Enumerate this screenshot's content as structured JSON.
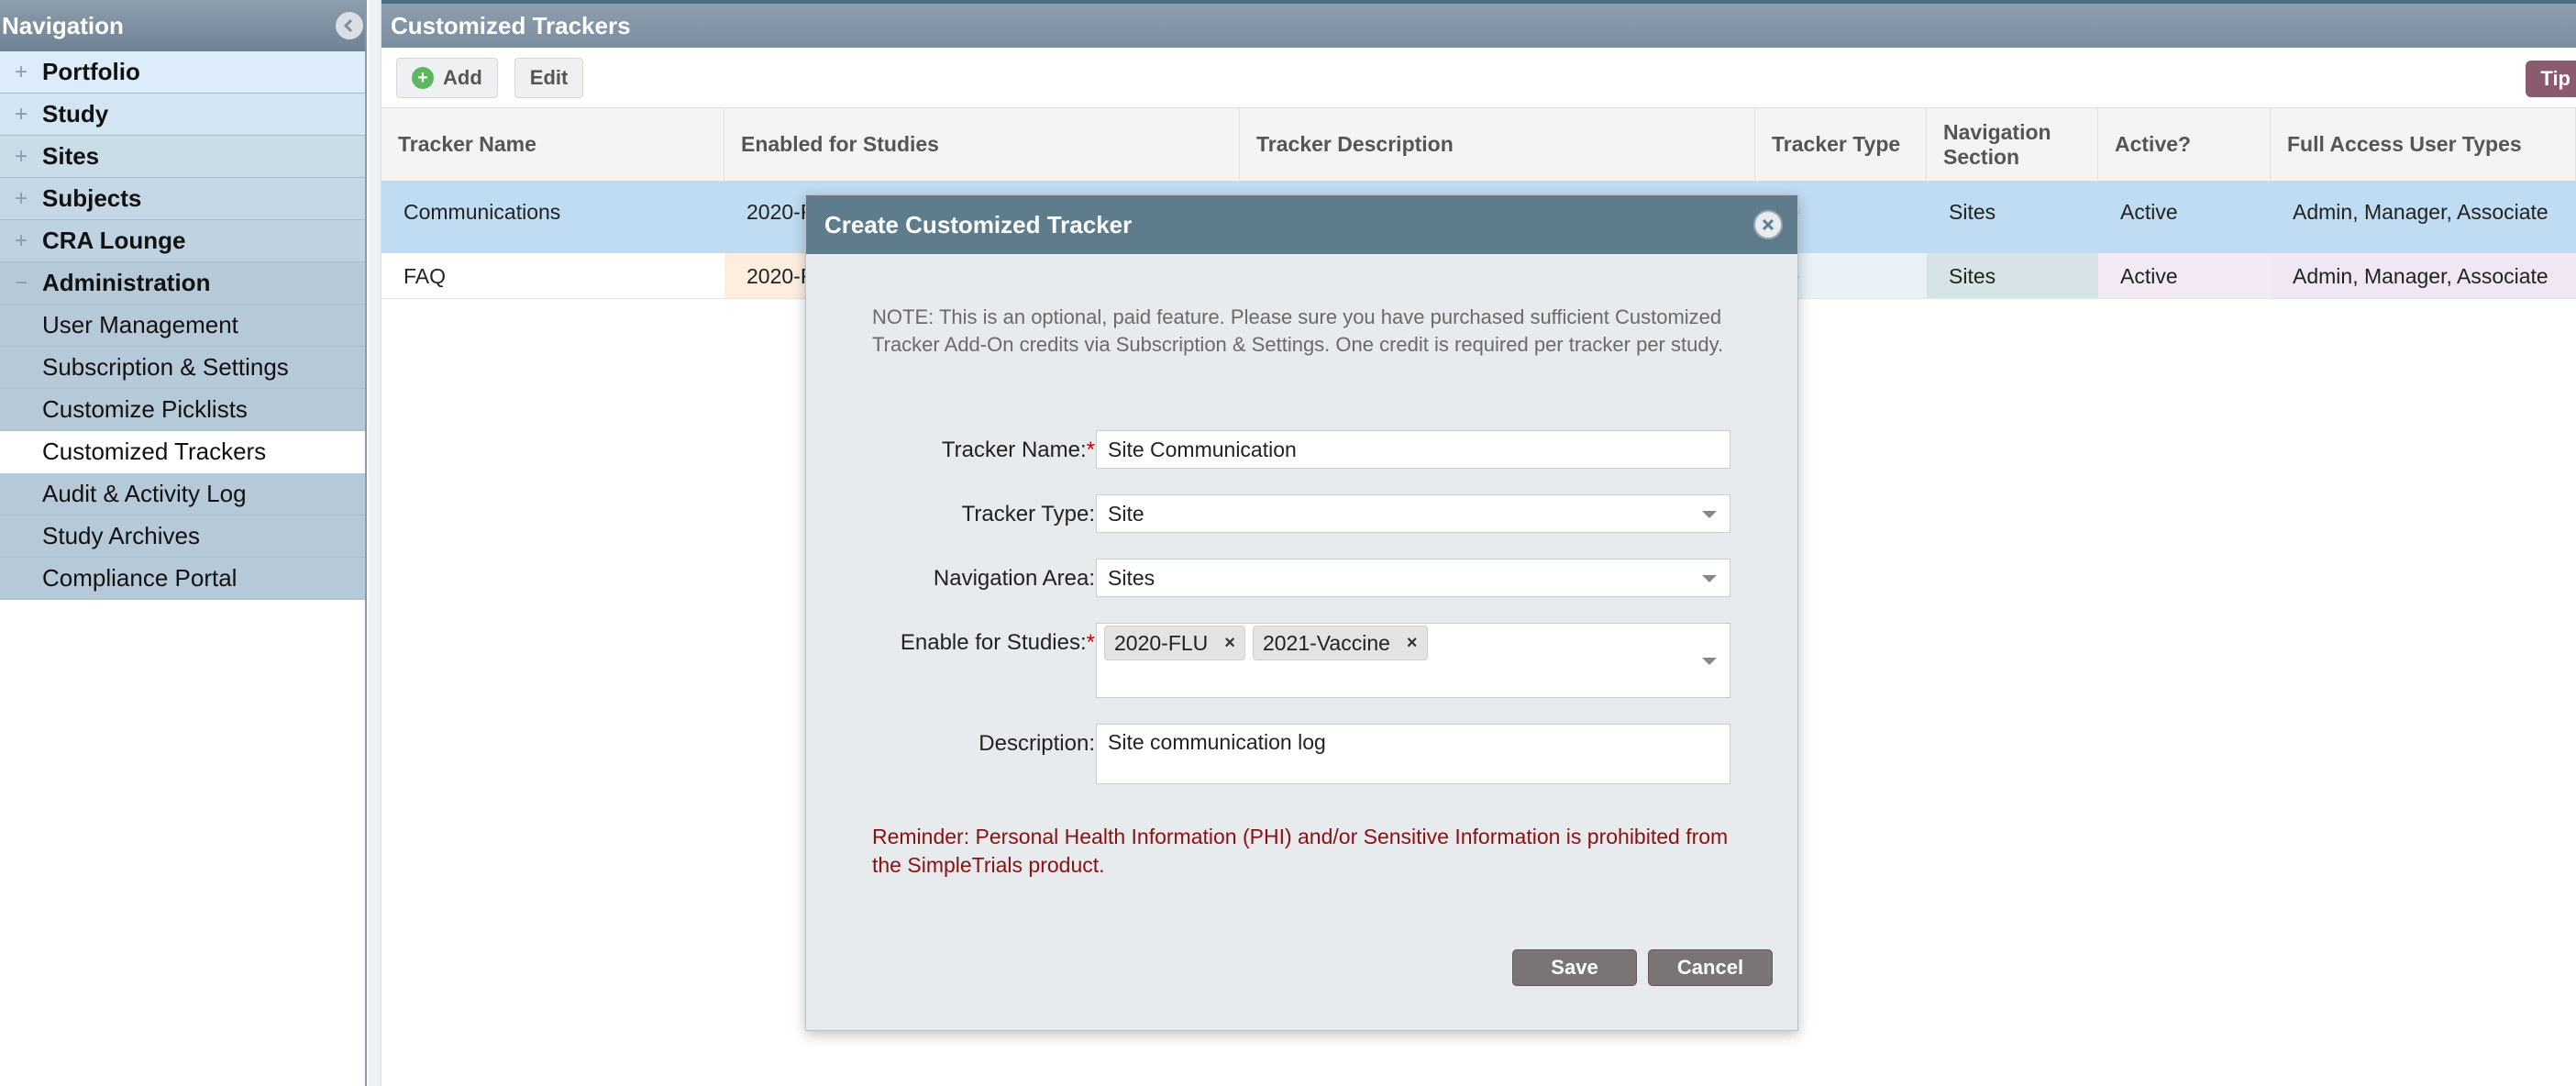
{
  "sidebar": {
    "title": "Navigation",
    "items": [
      {
        "label": "Portfolio",
        "toggle": "+"
      },
      {
        "label": "Study",
        "toggle": "+"
      },
      {
        "label": "Sites",
        "toggle": "+"
      },
      {
        "label": "Subjects",
        "toggle": "+"
      },
      {
        "label": "CRA Lounge",
        "toggle": "+"
      },
      {
        "label": "Administration",
        "toggle": "−"
      }
    ],
    "subitems": [
      {
        "label": "User Management"
      },
      {
        "label": "Subscription & Settings"
      },
      {
        "label": "Customize Picklists"
      },
      {
        "label": "Customized Trackers"
      },
      {
        "label": "Audit & Activity Log"
      },
      {
        "label": "Study Archives"
      },
      {
        "label": "Compliance Portal"
      }
    ]
  },
  "main": {
    "title": "Customized Trackers",
    "toolbar": {
      "add_label": "Add",
      "edit_label": "Edit",
      "tips_label": "Tip"
    }
  },
  "table": {
    "columns": [
      "Tracker Name",
      "Enabled for Studies",
      "Tracker Description",
      "Tracker Type",
      "Navigation Section",
      "Active?",
      "Full Access User Types"
    ],
    "rows": [
      {
        "name": "Communications",
        "studies": "2020-F",
        "description": "",
        "type": "ite",
        "section": "Sites",
        "active": "Active",
        "access": "Admin, Manager, Associate"
      },
      {
        "name": "FAQ",
        "studies": "2020-F",
        "description": "",
        "type": "ite",
        "section": "Sites",
        "active": "Active",
        "access": "Admin, Manager, Associate"
      }
    ]
  },
  "modal": {
    "title": "Create Customized Tracker",
    "note": "NOTE: This is an optional, paid feature. Please sure you have purchased sufficient Customized Tracker Add-On credits via Subscription & Settings. One credit is required per tracker per study.",
    "fields": {
      "tracker_name_label": "Tracker Name:",
      "tracker_name_value": "Site Communication",
      "tracker_type_label": "Tracker Type:",
      "tracker_type_value": "Site",
      "nav_area_label": "Navigation Area:",
      "nav_area_value": "Sites",
      "studies_label": "Enable for Studies:",
      "studies_tags": [
        "2020-FLU",
        "2021-Vaccine"
      ],
      "description_label": "Description:",
      "description_value": "Site communication log",
      "required_mark": "*",
      "remove_mark": "×"
    },
    "reminder": "Reminder: Personal Health Information (PHI) and/or Sensitive Information is prohibited from the SimpleTrials product.",
    "save_label": "Save",
    "cancel_label": "Cancel"
  },
  "colors": {
    "header": "#7b8d9f",
    "modal_header": "#5f7c8c",
    "selected_row": "#bfdcf2",
    "reminder_text": "#8b1010",
    "button": "#7a7476"
  }
}
